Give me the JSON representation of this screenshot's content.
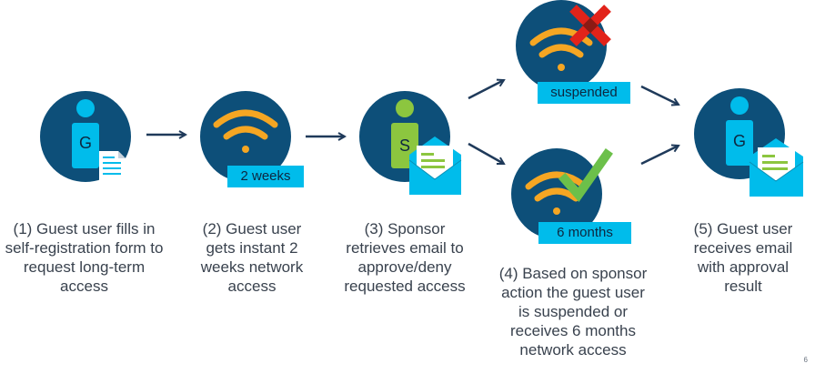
{
  "steps": [
    {
      "caption": "(1) Guest user fills in self-registration form to request long-term access",
      "avatar_letter": "G"
    },
    {
      "caption": "(2) Guest user gets instant 2 weeks network access",
      "badge": "2 weeks"
    },
    {
      "caption": "(3) Sponsor retrieves email to approve/deny requested access",
      "avatar_letter": "S"
    },
    {
      "caption": "(4) Based on sponsor action the guest user is suspended or receives 6 months network access",
      "badge_top": "suspended",
      "badge_bottom": "6 months"
    },
    {
      "caption": "(5) Guest user receives email with approval result",
      "avatar_letter": "G"
    }
  ],
  "page_number": "6",
  "colors": {
    "circle": "#0d4f79",
    "person_guest": "#00bceb",
    "person_sponsor": "#8cc63f",
    "wifi": "#f5a623",
    "badge": "#00bceb",
    "deny": "#e2231a",
    "approve": "#6cc04a",
    "arrow": "#1f3a5a",
    "text": "#39424e"
  }
}
